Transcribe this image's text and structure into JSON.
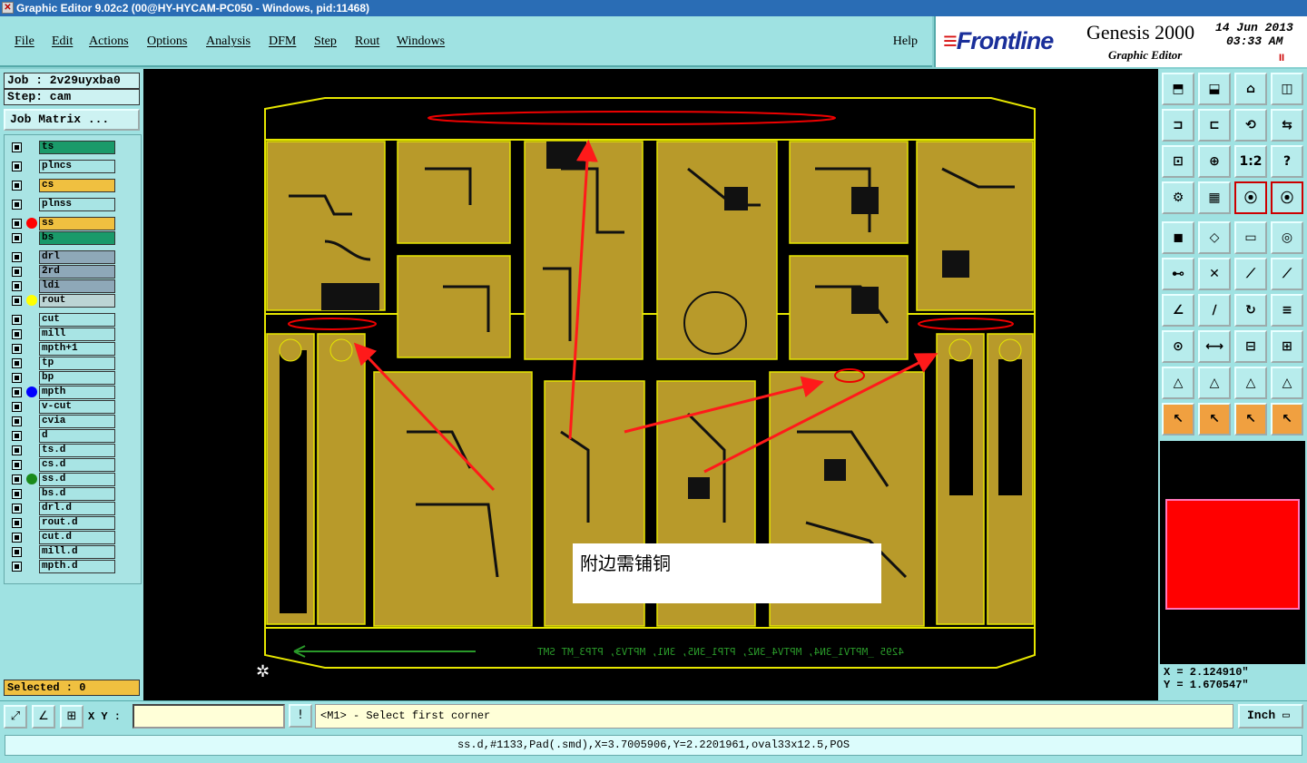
{
  "window": {
    "title": "Graphic Editor 9.02c2 (00@HY-HYCAM-PC050 - Windows, pid:11468)"
  },
  "menu": {
    "items": [
      "File",
      "Edit",
      "Actions",
      "Options",
      "Analysis",
      "DFM",
      "Step",
      "Rout",
      "Windows"
    ],
    "help": "Help"
  },
  "brand": {
    "logo_prefix": "≡",
    "logo": "Frontline",
    "product": "Genesis 2000",
    "subtitle": "Graphic Editor",
    "date": "14 Jun 2013",
    "time": "03:33 AM",
    "pause": "II"
  },
  "job": {
    "job": "Job : 2v29uyxba0",
    "step": "Step: cam",
    "matrix_button": "Job Matrix ..."
  },
  "layers": [
    {
      "name": "ts",
      "color": "#1a9a6a",
      "dot": ""
    },
    {
      "name": "plncs",
      "color": "#a8e4e4",
      "dot": ""
    },
    {
      "name": "cs",
      "color": "#f0c040",
      "dot": ""
    },
    {
      "name": "plnss",
      "color": "#a8e4e4",
      "dot": ""
    },
    {
      "name": "ss",
      "color": "#f0c040",
      "dot": "#ff0000"
    },
    {
      "name": "bs",
      "color": "#1a9a6a",
      "dot": ""
    },
    {
      "name": "drl",
      "color": "#8ea8b8",
      "dot": ""
    },
    {
      "name": "2rd",
      "color": "#8ea8b8",
      "dot": ""
    },
    {
      "name": "ldi",
      "color": "#8ea8b8",
      "dot": ""
    },
    {
      "name": "rout",
      "color": "#bcd4d4",
      "dot": "#ffff00"
    },
    {
      "name": "cut",
      "color": "#a8e4e4",
      "dot": ""
    },
    {
      "name": "mill",
      "color": "#a8e4e4",
      "dot": ""
    },
    {
      "name": "mpth+1",
      "color": "#a8e4e4",
      "dot": ""
    },
    {
      "name": "tp",
      "color": "#a8e4e4",
      "dot": ""
    },
    {
      "name": "bp",
      "color": "#a8e4e4",
      "dot": ""
    },
    {
      "name": "mpth",
      "color": "#a8e4e4",
      "dot": "#0000ff"
    },
    {
      "name": "v-cut",
      "color": "#a8e4e4",
      "dot": ""
    },
    {
      "name": "cvia",
      "color": "#a8e4e4",
      "dot": ""
    },
    {
      "name": "d",
      "color": "#a8e4e4",
      "dot": ""
    },
    {
      "name": "ts.d",
      "color": "#a8e4e4",
      "dot": ""
    },
    {
      "name": "cs.d",
      "color": "#a8e4e4",
      "dot": ""
    },
    {
      "name": "ss.d",
      "color": "#a8e4e4",
      "dot": "#1a8a1a"
    },
    {
      "name": "bs.d",
      "color": "#a8e4e4",
      "dot": ""
    },
    {
      "name": "drl.d",
      "color": "#a8e4e4",
      "dot": ""
    },
    {
      "name": "rout.d",
      "color": "#a8e4e4",
      "dot": ""
    },
    {
      "name": "cut.d",
      "color": "#a8e4e4",
      "dot": ""
    },
    {
      "name": "mill.d",
      "color": "#a8e4e4",
      "dot": ""
    },
    {
      "name": "mpth.d",
      "color": "#a8e4e4",
      "dot": ""
    }
  ],
  "selected": "Selected : 0",
  "canvas": {
    "note": "附边需铺铜",
    "mirrored_text": "4295  _MPTV1_3N4, MPTV4_3N2, PTP1_3N5, 3N1, MPTV3, PTP3_MT  SMT"
  },
  "tools": {
    "labels": {
      "scale_1_2": "1:2",
      "help": "?"
    }
  },
  "coords": {
    "x": "X = 2.124910\"",
    "y": "Y = 1.670547\""
  },
  "bottom": {
    "xy_label": "X Y :",
    "xy_value": "",
    "warn": "!",
    "prompt": "<M1> - Select first corner",
    "units": "Inch"
  },
  "status": "ss.d,#1133,Pad(.smd),X=3.7005906,Y=2.2201961,oval33x12.5,POS"
}
